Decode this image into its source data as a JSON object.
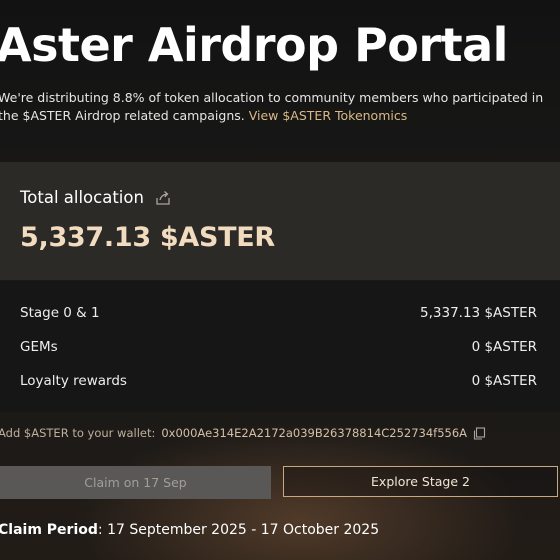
{
  "header": {
    "title": "Aster Airdrop Portal",
    "description": "We're distributing 8.8% of token allocation to community members who participated in the $ASTER Airdrop related campaigns.",
    "link_text": "View $ASTER Tokenomics"
  },
  "allocation": {
    "label": "Total allocation",
    "amount": "5,337.13 $ASTER",
    "rows": [
      {
        "label": "Stage 0 & 1",
        "value": "5,337.13 $ASTER"
      },
      {
        "label": "GEMs",
        "value": "0 $ASTER"
      },
      {
        "label": "Loyalty rewards",
        "value": "0 $ASTER"
      }
    ]
  },
  "wallet": {
    "label": "Add $ASTER to your wallet:",
    "address": "0x000Ae314E2A2172a039B26378814C252734f556A"
  },
  "buttons": {
    "claim_label": "Claim on 17 Sep",
    "explore_label": "Explore Stage 2"
  },
  "claim_period": {
    "label": "Claim Period",
    "value": "17 September 2025 - 17 October 2025"
  },
  "icons": {
    "share": "share-icon",
    "copy": "copy-icon"
  },
  "colors": {
    "accent": "#f2dcc0",
    "link": "#d9b98a",
    "button_border": "#c9a77f"
  }
}
